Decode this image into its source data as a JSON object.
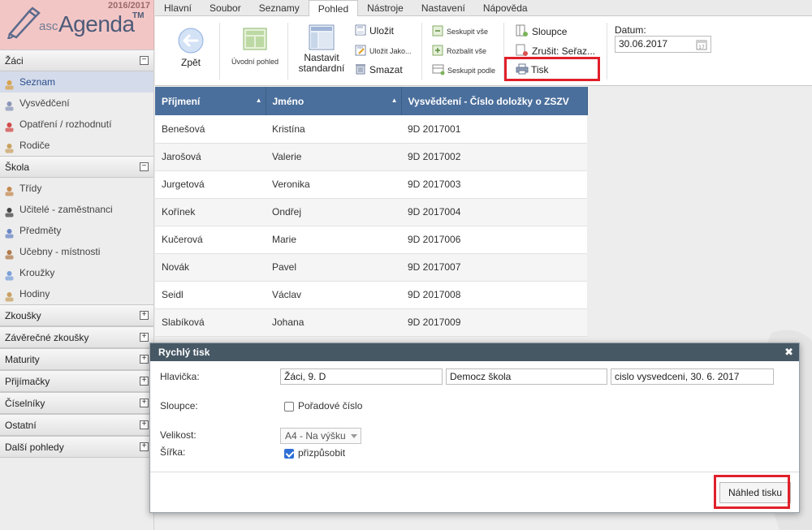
{
  "app": {
    "year": "2016/2017",
    "brand_small": "asc",
    "brand_main": "Agenda",
    "brand_tm": "TM"
  },
  "menu": [
    "Hlavní",
    "Soubor",
    "Seznamy",
    "Pohled",
    "Nástroje",
    "Nastavení",
    "Nápověda"
  ],
  "ribbon": {
    "back": "Zpět",
    "home_view": "Úvodní pohled",
    "set_default_1": "Nastavit",
    "set_default_2": "standardní",
    "save": "Uložit",
    "save_as": "Uložit Jako...",
    "delete": "Smazat",
    "collapse_all": "Seskupit vše",
    "expand_all": "Rozbalit vše",
    "group_by": "Seskupit podle",
    "columns": "Sloupce",
    "cancel_sort": "Zrušit: Seřaz...",
    "print": "Tisk",
    "date_label": "Datum:",
    "date_value": "30.06.2017"
  },
  "sidebar": {
    "sections": [
      {
        "title": "Žáci",
        "toggle": "−",
        "items": [
          "Seznam",
          "Vysvědčení",
          "Opatření / rozhodnutí",
          "Rodiče"
        ]
      },
      {
        "title": "Škola",
        "toggle": "−",
        "items": [
          "Třídy",
          "Učitelé - zaměstnanci",
          "Předměty",
          "Učebny - místnosti",
          "Kroužky",
          "Hodiny"
        ]
      },
      {
        "title": "Zkoušky",
        "toggle": "+",
        "items": []
      },
      {
        "title": "Závěrečné zkoušky",
        "toggle": "+",
        "items": []
      },
      {
        "title": "Maturity",
        "toggle": "+",
        "items": []
      },
      {
        "title": "Přijímačky",
        "toggle": "+",
        "items": []
      },
      {
        "title": "Číselníky",
        "toggle": "+",
        "items": []
      },
      {
        "title": "Ostatní",
        "toggle": "+",
        "items": []
      },
      {
        "title": "Další pohledy",
        "toggle": "+",
        "items": []
      }
    ]
  },
  "table": {
    "headers": [
      "Příjmení",
      "Jméno",
      "Vysvědčení - Číslo doložky o ZSZV"
    ],
    "rows": [
      [
        "Benešová",
        "Kristína",
        "9D 2017001"
      ],
      [
        "Jarošová",
        "Valerie",
        "9D 2017002"
      ],
      [
        "Jurgetová",
        "Veronika",
        "9D 2017003"
      ],
      [
        "Kořínek",
        "Ondřej",
        "9D 2017004"
      ],
      [
        "Kučerová",
        "Marie",
        "9D 2017006"
      ],
      [
        "Novák",
        "Pavel",
        "9D 2017007"
      ],
      [
        "Seidl",
        "Václav",
        "9D 2017008"
      ],
      [
        "Slabíková",
        "Johana",
        "9D 2017009"
      ]
    ]
  },
  "dialog": {
    "title": "Rychlý tisk",
    "close": "✖",
    "header_label": "Hlavička:",
    "header_1": "Žáci, 9. D",
    "header_2": "Democz škola",
    "header_3": "cislo vysvedceni, 30. 6. 2017",
    "columns_label": "Sloupce:",
    "order_number": "Pořadové číslo",
    "size_label": "Velikost:",
    "size_value": "A4 - Na výšku",
    "width_label": "Šířka:",
    "fit": "přizpůsobit",
    "preview_button": "Náhled tisku"
  }
}
